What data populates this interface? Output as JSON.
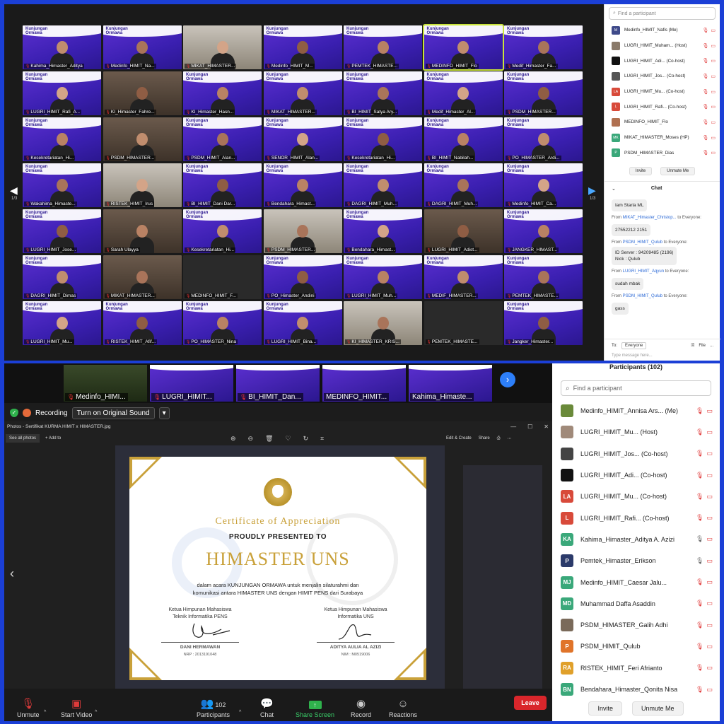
{
  "top": {
    "gallery": {
      "brand_text": "Kunjungan Ormawa",
      "tiles": [
        "Kahima_Himaster_Aditya",
        "Medinfo_HIMIT_Na...",
        "MIKAT_HIMASTER...",
        "Medinfo_HIMIT_M...",
        "PEMTEK_HIMASTE...",
        "MEDINFO_HIMIT_Flo",
        "Medif_Himaster_Fa...",
        "LUGRI_HIMIT_Rafi_A...",
        "KI_Himaster_Fahre...",
        "KI_Himaster_Hasn...",
        "MIKAT_HIMASTER...",
        "BI_HIMIT_Satya Ary...",
        "Medif_Himaster_Al...",
        "PSDM_HIMASTER...",
        "Kesekretariatan_Hi...",
        "PSDM_HIMASTER...",
        "PSDM_HIMIT_Alan...",
        "SENOR_HIMIT_Alan...",
        "Kesekretariatan_Hi...",
        "BI_HIMIT_Nabilah...",
        "PO_HIMASTER_Ardi...",
        "Wakahima_Himaste...",
        "RISTEK_HIMIT_Irus",
        "BI_HIMIT_Dani Dar...",
        "Bendahara_Himast...",
        "DAGRI_HIMIT_Muh...",
        "DAGRI_HIMIT_Muh...",
        "Medinfo_HIMIT_Ca...",
        "LUGRI_HIMIT_Jose...",
        "Sarah Ulayya",
        "Kesekretariatan_Hi...",
        "PSDM_HIMASTER...",
        "Bendahara_Himast...",
        "LUGRI_HIMIT_Adist...",
        "JANGKER_HIMAST...",
        "DAGRI_HIMIT_Dimas",
        "MIKAT_HIMASTER...",
        "MEDINFO_HIMIT_F...",
        "PO_Himaster_Andini",
        "LUGRI_HIMIT_Muh...",
        "MEDIF_HIMASTER...",
        "PEMTEK_HIMASTE...",
        "LUGRI_HIMIT_Mu...",
        "RISTEK_HIMIT_Afif...",
        "PO_HIMASTER_Nina",
        "LUGRI_HIMIT_Bina...",
        "KI_HIMASTER_KRIS...",
        "PEMTEK_HIMASTE...",
        "Jangker_Himaster..."
      ],
      "page_left": "1/3",
      "page_right": "1/3"
    },
    "panel": {
      "search_placeholder": "Find a participant",
      "participants": [
        {
          "avatar": "M",
          "name": "Medinfo_HIMIT_Nafis (Me)",
          "color": "#3f4a8a"
        },
        {
          "avatar": "",
          "name": "LUGRI_HIMIT_Muham... (Host)",
          "color": "#8a7a6a"
        },
        {
          "avatar": "",
          "name": "LUGRI_HIMIT_Adi... (Co-host)",
          "color": "#111111"
        },
        {
          "avatar": "",
          "name": "LUGRI_HIMIT_Jos... (Co-host)",
          "color": "#555555"
        },
        {
          "avatar": "LA",
          "name": "LUGRI_HIMIT_Mu... (Co-host)",
          "color": "#d84a3a"
        },
        {
          "avatar": "L",
          "name": "LUGRI_HIMIT_Rafi... (Co-host)",
          "color": "#d84a3a"
        },
        {
          "avatar": "",
          "name": "MEDINFO_HIMIT_Flo",
          "color": "#b07050"
        },
        {
          "avatar": "MK",
          "name": "MIKAT_HIMASTER_Moses (HP)",
          "color": "#3aa87a"
        },
        {
          "avatar": "P",
          "name": "PSDM_HIMASTER_Dias",
          "color": "#3aa87a"
        }
      ],
      "invite": "Invite",
      "unmute": "Unmute Me",
      "chat_title": "Chat",
      "chat_caret": "⌄",
      "messages": [
        {
          "from": "",
          "text": "Iam Starla ML"
        },
        {
          "from": "MIKAT_Himaster_Christop...",
          "to": "to Everyone:",
          "text": "27552212 2151"
        },
        {
          "from": "PSDM_HIMIT_Qulub",
          "to": "to Everyone:",
          "text": "ID Server : 94209485 (2196)\nNick : Qulub"
        },
        {
          "from": "LUGRI_HIMIT_Aqyun",
          "to": "to Everyone:",
          "text": "sudah mbak"
        },
        {
          "from": "PSDM_HIMIT_Qulub",
          "to": "to Everyone:",
          "text": "gass"
        }
      ],
      "from_label": "From",
      "to_label": "To:",
      "to_value": "Everyone",
      "file_label": "File",
      "more": "...",
      "input_placeholder": "Type message here..."
    }
  },
  "bottom": {
    "strip": [
      {
        "name": "Medinfo_HIMI...",
        "mute": true
      },
      {
        "name": "LUGRI_HIMIT...",
        "mute": true
      },
      {
        "name": "BI_HIMIT_Dan...",
        "mute": true
      },
      {
        "name": "MEDINFO_HIMIT...",
        "mute": false
      },
      {
        "name": "Kahima_Himaste...",
        "mute": false
      }
    ],
    "next_icon": "›",
    "shield_icon": "✓",
    "recording": "Recording",
    "original_sound": "Turn on Original Sound",
    "dropdown_caret": "▾",
    "photo": {
      "title": "Photos - Sertifikat KURMA HIMIT x HIMASTER.jpg",
      "see_all": "See all photos",
      "add_to": "Add to",
      "edit_create": "Edit & Create",
      "share": "Share",
      "window_min": "—",
      "window_max": "☐",
      "window_close": "✕",
      "prev_arrow": "‹",
      "mid_tools": [
        "⊕",
        "⊖",
        "🗑",
        "♡",
        "↻",
        "⌗"
      ]
    },
    "cert": {
      "title": "Certificate of Appreciation",
      "subtitle": "PROUDLY PRESENTED TO",
      "name": "HIMASTER UNS",
      "desc_line1": "dalam acara KUNJUNGAN ORMAWA untuk menjalin silaturahmi dan",
      "desc_line2": "komunikasi antara HIMASTER UNS dengan HIMIT PENS dari Surabaya",
      "left_role1": "Ketua Himpunan Mahasiswa",
      "left_role2": "Teknik Informatika PENS",
      "left_name": "DANI HERMAWAN",
      "left_id": "NRP : 2013191048",
      "right_role1": "Ketua Himpunan Mahasiswa",
      "right_role2": "Informatika UNS",
      "right_name": "ADITYA AULIA AL AZIZI",
      "right_id": "NIM : M0519006"
    },
    "panel": {
      "title": "Participants (102)",
      "search_placeholder": "Find a participant",
      "participants": [
        {
          "avatar": "",
          "name": "Medinfo_HIMIT_Annisa Ars... (Me)",
          "color": "#6a8a3a",
          "mic": "muted"
        },
        {
          "avatar": "",
          "name": "LUGRI_HIMIT_Mu... (Host)",
          "color": "#a08a7a",
          "mic": "muted"
        },
        {
          "avatar": "",
          "name": "LUGRI_HIMIT_Jos... (Co-host)",
          "color": "#444444",
          "mic": "muted"
        },
        {
          "avatar": "",
          "name": "LUGRI_HIMIT_Adi... (Co-host)",
          "color": "#111111",
          "mic": "muted"
        },
        {
          "avatar": "LA",
          "name": "LUGRI_HIMIT_Mu... (Co-host)",
          "color": "#d84a3a",
          "mic": "muted"
        },
        {
          "avatar": "L",
          "name": "LUGRI_HIMIT_Rafi... (Co-host)",
          "color": "#d84a3a",
          "mic": "muted"
        },
        {
          "avatar": "KA",
          "name": "Kahima_Himaster_Aditya A. Azizi",
          "color": "#3aa87a",
          "mic": "on"
        },
        {
          "avatar": "P",
          "name": "Pemtek_Himaster_Erikson",
          "color": "#2b3a6a",
          "mic": "on"
        },
        {
          "avatar": "MJ",
          "name": "Medinfo_HIMIT_Caesar Jalu...",
          "color": "#3aa87a",
          "mic": "muted"
        },
        {
          "avatar": "MD",
          "name": "Muhammad Daffa Asaddin",
          "color": "#3aa87a",
          "mic": "muted"
        },
        {
          "avatar": "",
          "name": "PSDM_HIMASTER_Galih Adhi",
          "color": "#7a6a5a",
          "mic": "muted"
        },
        {
          "avatar": "P",
          "name": "PSDM_HIMIT_Qulub",
          "color": "#e0742a",
          "mic": "muted"
        },
        {
          "avatar": "RA",
          "name": "RISTEK_HIMIT_Feri Afrianto",
          "color": "#e0a02a",
          "mic": "muted"
        },
        {
          "avatar": "BN",
          "name": "Bendahara_Himaster_Qonita Nisa",
          "color": "#3aa87a",
          "mic": "muted"
        }
      ],
      "invite": "Invite",
      "unmute": "Unmute Me"
    },
    "toolbar": {
      "unmute": "Unmute",
      "start_video": "Start Video",
      "participants": "Participants",
      "participants_count": "102",
      "chat": "Chat",
      "share_screen": "Share Screen",
      "record": "Record",
      "reactions": "Reactions",
      "leave": "Leave"
    }
  }
}
